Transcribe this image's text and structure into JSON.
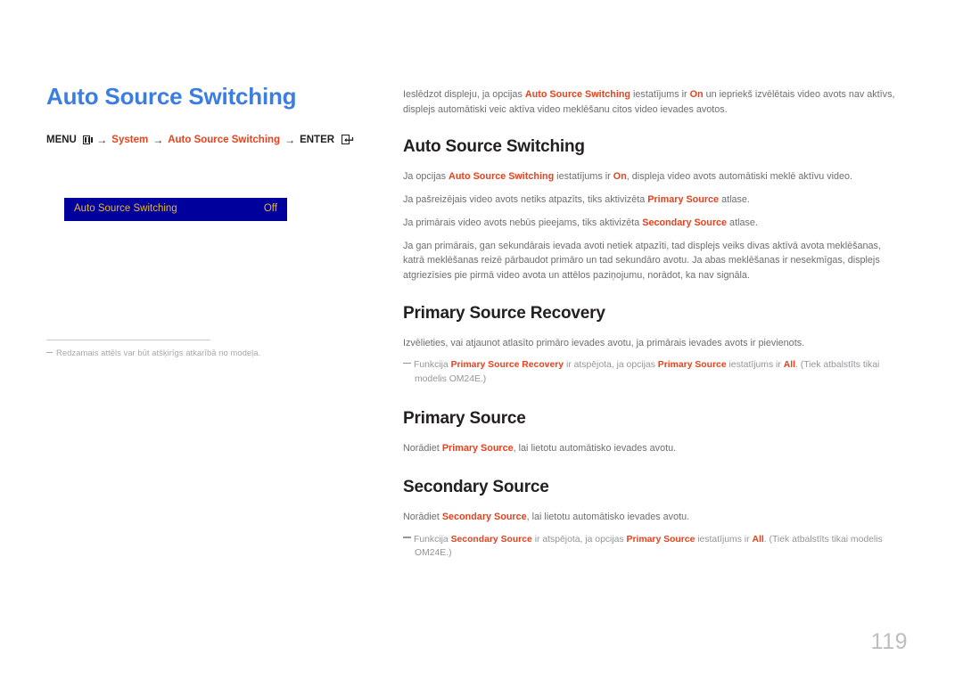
{
  "document": {
    "page_number": "119",
    "title": "Auto Source Switching"
  },
  "breadcrumb": {
    "menu_label": "MENU",
    "menu_icon": "menu-grid-icon",
    "arrow": "→",
    "item_system": "System",
    "item_auto_source_switching": "Auto Source Switching",
    "enter_label": "ENTER",
    "enter_icon": "enter-return-icon"
  },
  "osd_preview": {
    "label": "Auto Source Switching",
    "value": "Off",
    "background_color": "#00009c",
    "text_color": "#e9b928"
  },
  "left_footnote": {
    "text": "Redzamais attēls var būt atšķirīgs atkarībā no modeļa."
  },
  "intro": {
    "p1_a": "Ieslēdzot displeju, ja opcijas ",
    "p1_hl1": "Auto Source Switching",
    "p1_b": " iestatījums ir ",
    "p1_hl2": "On",
    "p1_c": " un iepriekš izvēlētais video avots nav aktīvs, displejs automātiski veic aktīva video meklēšanu citos video ievades avotos."
  },
  "sections": {
    "auto_source_switching": {
      "heading": "Auto Source Switching",
      "p1_a": "Ja opcijas ",
      "p1_hl1": "Auto Source Switching",
      "p1_b": " iestatījums ir ",
      "p1_hl2": "On",
      "p1_c": ", displeja video avots automātiski meklē aktīvu video.",
      "p2_a": "Ja pašreizējais video avots netiks atpazīts, tiks aktivizēta ",
      "p2_hl": "Primary Source",
      "p2_b": " atlase.",
      "p3_a": "Ja primārais video avots nebūs pieejams, tiks aktivizēta ",
      "p3_hl": "Secondary Source",
      "p3_b": " atlase.",
      "p4": "Ja gan primārais, gan sekundārais ievada avoti netiek atpazīti, tad displejs veiks divas aktīvā avota meklēšanas, katrā meklēšanas reizē pārbaudot primāro un tad sekundāro avotu. Ja abas meklēšanas ir nesekmīgas, displejs atgriezīsies pie pirmā video avota un attēlos paziņojumu, norādot, ka nav signāla."
    },
    "primary_source_recovery": {
      "heading": "Primary Source Recovery",
      "p1": "Izvēlieties, vai atjaunot atlasīto primāro ievades avotu, ja primārais ievades avots ir pievienots.",
      "note_a": "Funkcija ",
      "note_hl1": "Primary Source Recovery",
      "note_b": " ir atspējota, ja opcijas ",
      "note_hl2": "Primary Source",
      "note_c": " iestatījums ir ",
      "note_hl3": "All",
      "note_d": ". (Tiek atbalstīts tikai modelis OM24E.)"
    },
    "primary_source": {
      "heading": "Primary Source",
      "p1_a": "Norādiet ",
      "p1_hl": "Primary Source",
      "p1_b": ", lai lietotu automātisko ievades avotu."
    },
    "secondary_source": {
      "heading": "Secondary Source",
      "p1_a": "Norādiet ",
      "p1_hl": "Secondary Source",
      "p1_b": ", lai lietotu automātisko ievades avotu.",
      "note_a": "Funkcija ",
      "note_hl1": "Secondary Source",
      "note_b": " ir atspējota, ja opcijas ",
      "note_hl2": "Primary Source",
      "note_c": " iestatījums ir ",
      "note_hl3": "All",
      "note_d": ". (Tiek atbalstīts tikai modelis OM24E.)"
    }
  },
  "colors": {
    "title_blue": "#3c7ee0",
    "accent_red": "#e8411c",
    "body_gray": "#6d6e71",
    "note_gray": "#939598",
    "osd_blue": "#00009c",
    "osd_gold": "#e9b928",
    "page_number_gray": "#bcbec0"
  }
}
